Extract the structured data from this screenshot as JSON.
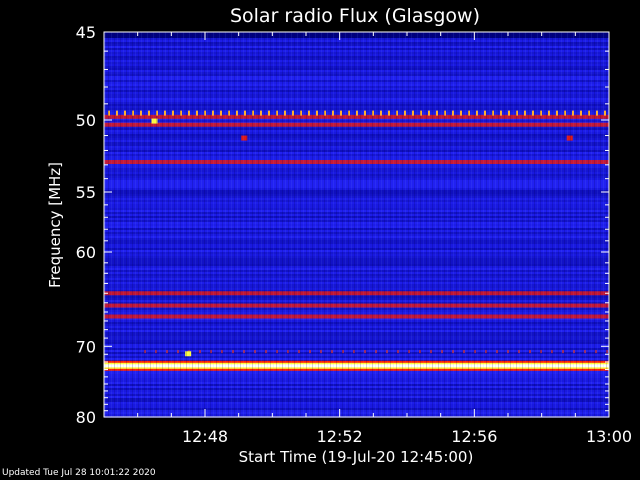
{
  "footer": {
    "updated": "Updated Tue Jul 28 10:01:22 2020"
  },
  "chart_data": {
    "type": "heatmap",
    "title": "Solar radio Flux (Glasgow)",
    "xlabel": "Start Time (19-Jul-20 12:45:00)",
    "ylabel": "Frequency [MHz]",
    "x_unit": "minutes",
    "x_range": [
      "12:45",
      "13:00"
    ],
    "xticks": [
      "12:48",
      "12:52",
      "12:56",
      "13:00"
    ],
    "xtick_minutes": [
      3,
      7,
      11,
      15
    ],
    "y_range": [
      45,
      80
    ],
    "y_inverted": true,
    "y_scale": "reciprocal",
    "yticks": [
      45,
      50,
      55,
      60,
      70,
      80
    ],
    "colormap": {
      "background": "#1a1ae0",
      "scale": [
        "#000066",
        "#1010d0",
        "#3070ff",
        "#ff2020",
        "#ffff40",
        "#ffffff"
      ]
    },
    "bands": [
      {
        "freq": 49.8,
        "level": 0.55
      },
      {
        "freq": 50.3,
        "level": 0.6
      },
      {
        "freq": 52.8,
        "level": 0.7
      },
      {
        "freq": 64.0,
        "level": 0.7
      },
      {
        "freq": 65.3,
        "level": 0.5
      },
      {
        "freq": 66.5,
        "level": 0.55
      },
      {
        "freq": 72.5,
        "level": 1.0
      }
    ],
    "features": [
      {
        "time": "12:46:30",
        "freq": 50.1,
        "level": 0.8
      },
      {
        "time": "12:47:30",
        "freq": 71.0,
        "level": 0.85
      },
      {
        "time": "12:49:10",
        "freq": 51.2,
        "level": 0.6
      },
      {
        "time": "12:58:50",
        "freq": 51.2,
        "level": 0.6
      }
    ]
  }
}
